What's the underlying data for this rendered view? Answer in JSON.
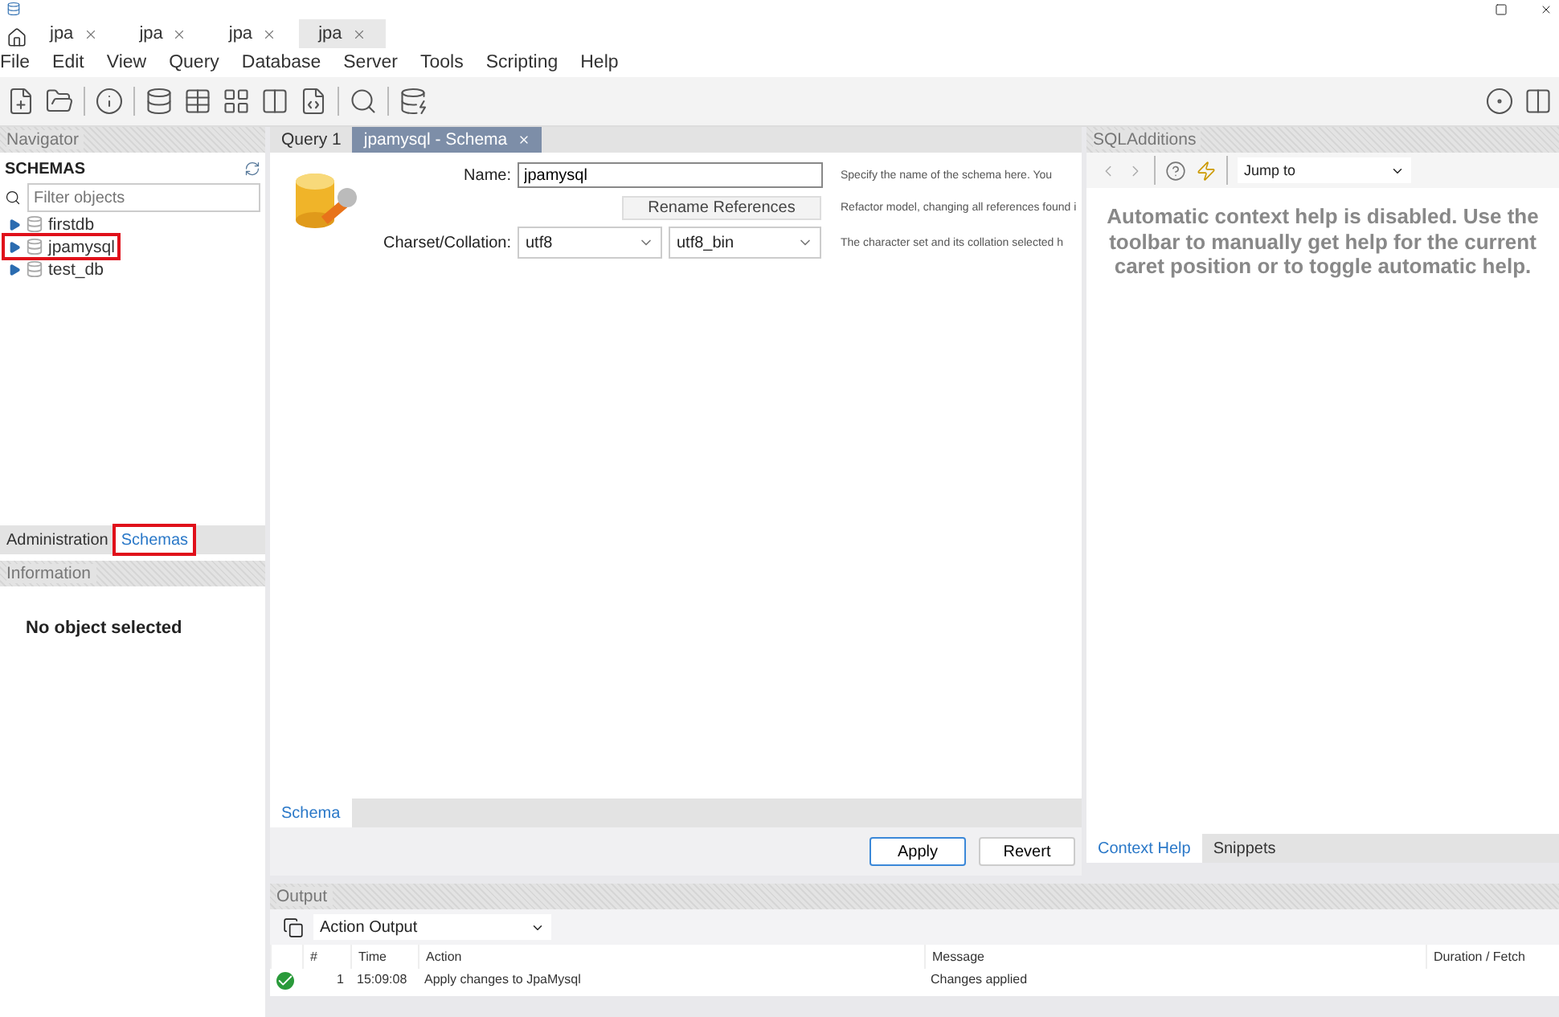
{
  "tabs": [
    {
      "label": "jpa",
      "selected": false
    },
    {
      "label": "jpa",
      "selected": false
    },
    {
      "label": "jpa",
      "selected": false
    },
    {
      "label": "jpa",
      "selected": true
    }
  ],
  "menu": [
    "File",
    "Edit",
    "View",
    "Query",
    "Database",
    "Server",
    "Tools",
    "Scripting",
    "Help"
  ],
  "navigator": {
    "title": "Navigator",
    "heading": "SCHEMAS",
    "filter_placeholder": "Filter objects",
    "schemas": [
      {
        "name": "firstdb",
        "highlighted": false
      },
      {
        "name": "jpamysql",
        "highlighted": true
      },
      {
        "name": "test_db",
        "highlighted": false
      }
    ],
    "tabs": [
      {
        "label": "Administration",
        "selected": false,
        "highlighted": false
      },
      {
        "label": "Schemas",
        "selected": true,
        "highlighted": true
      }
    ]
  },
  "information": {
    "title": "Information",
    "message": "No object selected"
  },
  "editor": {
    "tabs": [
      {
        "label": "Query 1",
        "selected": false,
        "closable": false
      },
      {
        "label": "jpamysql - Schema",
        "selected": true,
        "closable": true
      }
    ],
    "form": {
      "name_label": "Name:",
      "name_value": "jpamysql",
      "rename_button": "Rename References",
      "charset_label": "Charset/Collation:",
      "charset": "utf8",
      "collation": "utf8_bin",
      "hints": [
        "Specify the name of the schema here. You",
        "Refactor model, changing all references found i",
        "The character set and its collation selected h"
      ]
    },
    "bottom_tabs": [
      {
        "label": "Schema",
        "selected": true
      }
    ],
    "buttons": [
      {
        "label": "Apply",
        "default": true
      },
      {
        "label": "Revert",
        "default": false
      }
    ]
  },
  "sql_additions": {
    "title": "SQLAdditions",
    "jump_to": "Jump to",
    "help": "Automatic context help is disabled. Use the toolbar to manually get help for the current caret position or to toggle automatic help.",
    "tabs": [
      {
        "label": "Context Help",
        "selected": true
      },
      {
        "label": "Snippets",
        "selected": false
      }
    ]
  },
  "output": {
    "title": "Output",
    "mode": "Action Output",
    "columns": [
      "#",
      "Time",
      "Action",
      "Message",
      "Duration / Fetch"
    ],
    "rows": [
      {
        "succeeded": true,
        "number": "1",
        "time": "15:09:08",
        "action": "Apply changes to JpaMysql",
        "message": "Changes applied"
      }
    ]
  }
}
